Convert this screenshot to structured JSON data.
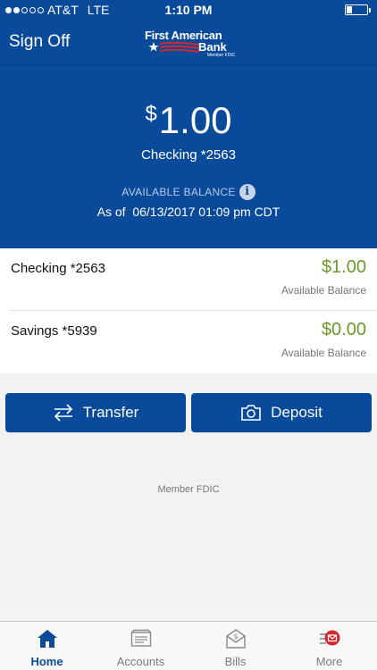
{
  "status_bar": {
    "carrier": "AT&T",
    "network": "LTE",
    "time": "1:10 PM",
    "battery_level": 0.25
  },
  "header": {
    "sign_off_label": "Sign Off",
    "logo_line1": "First American",
    "logo_line2": "Bank",
    "logo_fdic": "Member FDIC"
  },
  "summary": {
    "currency_symbol": "$",
    "amount": "1.00",
    "account_name": "Checking *2563",
    "balance_label": "AVAILABLE BALANCE",
    "as_of_prefix": "As of",
    "as_of_datetime": "06/13/2017 01:09 pm CDT"
  },
  "accounts": [
    {
      "name": "Checking *2563",
      "balance": "$1.00",
      "balance_label": "Available Balance"
    },
    {
      "name": "Savings *5939",
      "balance": "$0.00",
      "balance_label": "Available Balance"
    }
  ],
  "actions": {
    "transfer_label": "Transfer",
    "deposit_label": "Deposit"
  },
  "footer": {
    "member_text": "Member FDIC"
  },
  "tabs": [
    {
      "label": "Home",
      "icon": "home-icon",
      "active": true
    },
    {
      "label": "Accounts",
      "icon": "accounts-icon",
      "active": false
    },
    {
      "label": "Bills",
      "icon": "bills-icon",
      "active": false
    },
    {
      "label": "More",
      "icon": "more-icon",
      "active": false
    }
  ],
  "colors": {
    "brand_blue": "#0a4a9a",
    "balance_green": "#6a9a2a",
    "logo_red": "#d0282e",
    "notification_red": "#d0282e"
  }
}
